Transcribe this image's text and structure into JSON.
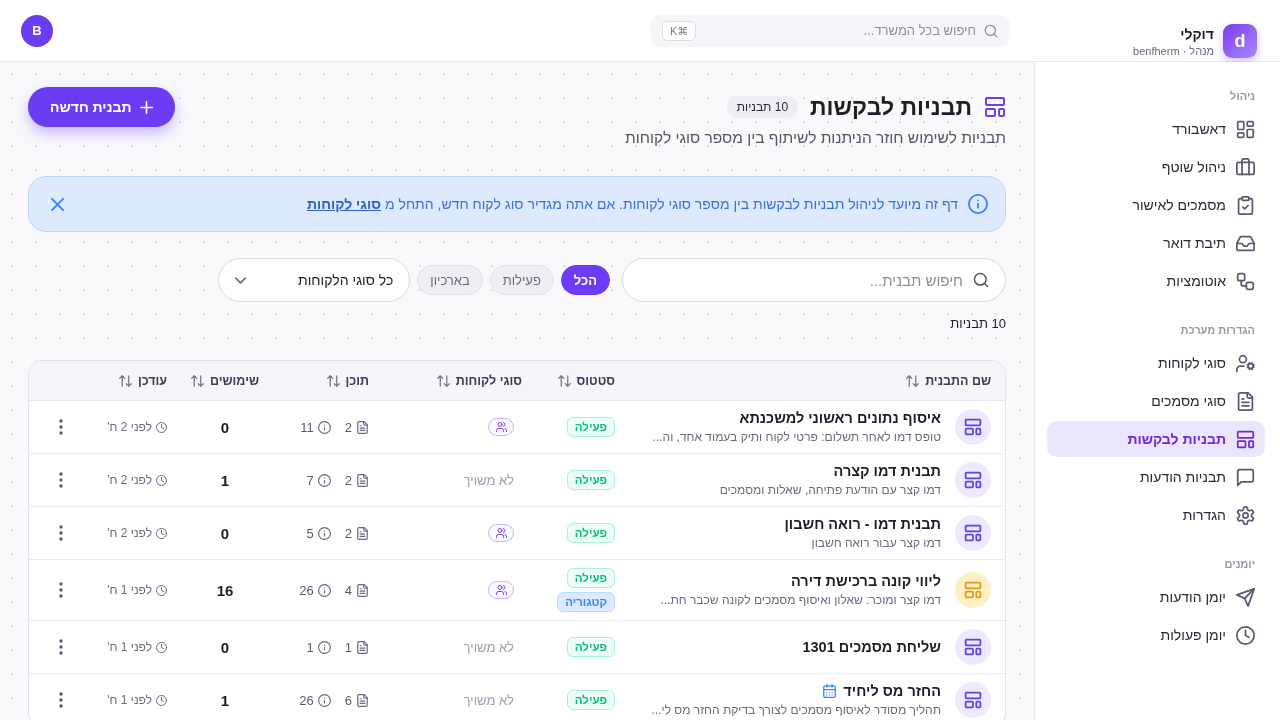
{
  "brand": {
    "logo": "d",
    "name": "דוקלי",
    "subtitle": "מנהל · benfherm"
  },
  "header": {
    "search": {
      "placeholder": "חיפוש בכל המשרד...",
      "shortcut": "⌘K"
    },
    "avatar": "B"
  },
  "sidebar": {
    "sections": [
      {
        "title": "ניהול",
        "items": [
          {
            "label": "דאשבורד",
            "selected": false
          },
          {
            "label": "ניהול שוטף",
            "selected": false
          },
          {
            "label": "מסמכים לאישור",
            "selected": false
          },
          {
            "label": "תיבת דואר",
            "selected": false
          },
          {
            "label": "אוטומציות",
            "selected": false
          }
        ]
      },
      {
        "title": "הגדרות מערכת",
        "items": [
          {
            "label": "סוגי לקוחות",
            "selected": false
          },
          {
            "label": "סוגי מסמכים",
            "selected": false
          },
          {
            "label": "תבניות לבקשות",
            "selected": true
          },
          {
            "label": "תבניות הודעות",
            "selected": false
          },
          {
            "label": "הגדרות",
            "selected": false
          }
        ]
      },
      {
        "title": "יומנים",
        "items": [
          {
            "label": "יומן הודעות",
            "selected": false
          },
          {
            "label": "יומן פעולות",
            "selected": false
          }
        ]
      }
    ]
  },
  "page": {
    "title": "תבניות לבקשות",
    "count_badge": "10 תבניות",
    "subtitle": "תבניות לשימוש חוזר הניתנות לשיתוף בין מספר סוגי לקוחות",
    "new_button": "תבנית חדשה"
  },
  "info_banner": {
    "text": "דף זה מיועד לניהול תבניות לבקשות בין מספר סוגי לקוחות. אם אתה מגדיר סוג לקוח חדש, התחל מ",
    "link": "סוגי לקוחות"
  },
  "filters": {
    "search": {
      "placeholder": "חיפוש תבנית..."
    },
    "chips": [
      {
        "label": "הכל",
        "selected": true
      },
      {
        "label": "פעילות",
        "selected": false
      },
      {
        "label": "בארכיון",
        "selected": false
      }
    ],
    "customer_type_select": {
      "value": "כל סוגי הלקוחות"
    }
  },
  "result_count": "10 תבניות",
  "table": {
    "columns": [
      "שם התבנית",
      "סטטוס",
      "סוגי לקוחות",
      "תוכן",
      "שימושים",
      "עודכן"
    ],
    "rows": [
      {
        "color": "#ede9fe",
        "title": "איסוף נתונים ראשוני למשכנתא",
        "scheduled": false,
        "description": "טופס דמו לאחר תשלום: פרטי לקוח ותיק בעמוד אחד, וה...",
        "badges": [
          {
            "label": "פעילה",
            "kind": "active"
          }
        ],
        "customer_types": {
          "kind": "chip"
        },
        "content": {
          "documents": "2",
          "items": "11"
        },
        "uses": "0",
        "updated": "לפני 2 ח'"
      },
      {
        "color": "#ede9fe",
        "title": "תבנית דמו קצרה",
        "scheduled": false,
        "description": "דמו קצר עם הודעת פתיחה, שאלות ומסמכים",
        "badges": [
          {
            "label": "פעילה",
            "kind": "active"
          }
        ],
        "customer_types": {
          "kind": "text",
          "text": "לא משויך"
        },
        "content": {
          "documents": "2",
          "items": "7"
        },
        "uses": "1",
        "updated": "לפני 2 ח'"
      },
      {
        "color": "#ede9fe",
        "title": "תבנית דמו - רואה חשבון",
        "scheduled": false,
        "description": "דמו קצר עבור רואה חשבון",
        "badges": [
          {
            "label": "פעילה",
            "kind": "active"
          }
        ],
        "customer_types": {
          "kind": "chip"
        },
        "content": {
          "documents": "2",
          "items": "5"
        },
        "uses": "0",
        "updated": "לפני 2 ח'"
      },
      {
        "color": "#fef0c4",
        "title": "ליווי קונה ברכישת דירה",
        "scheduled": false,
        "description": "דמו קצר ומוכר: שאלון ואיסוף מסמכים לקונה שכבר חת...",
        "badges": [
          {
            "label": "פעילה",
            "kind": "active"
          },
          {
            "label": "קטגוריה",
            "kind": "category"
          }
        ],
        "customer_types": {
          "kind": "chip"
        },
        "content": {
          "documents": "4",
          "items": "26"
        },
        "uses": "16",
        "updated": "לפני 1 ח'"
      },
      {
        "color": "#ede9fe",
        "title": "שליחת מסמכים 1301",
        "scheduled": false,
        "badges": [
          {
            "label": "פעילה",
            "kind": "active"
          }
        ],
        "customer_types": {
          "kind": "text",
          "text": "לא משויך"
        },
        "content": {
          "documents": "1",
          "items": "1"
        },
        "uses": "0",
        "updated": "לפני 1 ח'"
      },
      {
        "color": "#ede9fe",
        "title": "החזר מס ליחיד",
        "scheduled": true,
        "description": "תהליך מסודר לאיסוף מסמכים לצורך בדיקת החזר מס לי...",
        "badges": [
          {
            "label": "פעילה",
            "kind": "active"
          }
        ],
        "customer_types": {
          "kind": "text",
          "text": "לא משויך"
        },
        "content": {
          "documents": "6",
          "items": "26"
        },
        "uses": "1",
        "updated": "לפני 1 ח'"
      }
    ]
  }
}
